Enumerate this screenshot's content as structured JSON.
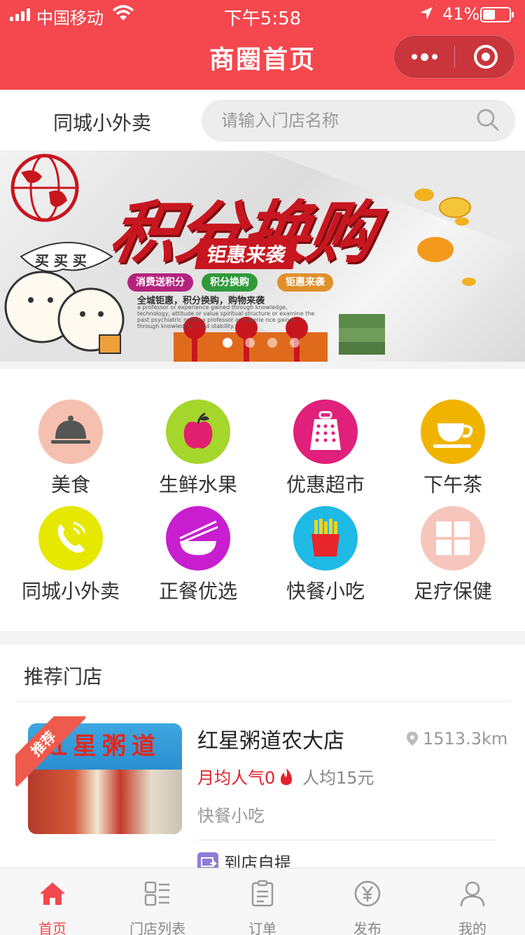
{
  "status_bar": {
    "carrier": "中国移动",
    "time": "下午5:58",
    "battery": "41%"
  },
  "nav": {
    "title": "商圈首页"
  },
  "search": {
    "city": "同城小外卖",
    "placeholder": "请输入门店名称"
  },
  "banner": {
    "headline": "积分换购",
    "subheadline": "钜惠来袭",
    "tags": [
      "消费送积分",
      "积分换购",
      "钜惠来袭"
    ],
    "line1": "全城钜惠，积分换购，购物来袭",
    "line2": "a professor or experience gained through knowledge, technology, attitude or value spiritual structure or examine the past psychiatric nodes a professor or experie nce gained through knowledge. r and stability.",
    "bubble": "买 买 买",
    "slide_count": 4,
    "active_slide": 0
  },
  "categories": [
    {
      "label": "美食",
      "icon": "cloche-icon",
      "color": "#f5c0b0"
    },
    {
      "label": "生鲜水果",
      "icon": "apple-icon",
      "color": "#a5d62b"
    },
    {
      "label": "优惠超市",
      "icon": "grater-icon",
      "color": "#e0207a"
    },
    {
      "label": "下午茶",
      "icon": "teacup-icon",
      "color": "#f0b400"
    },
    {
      "label": "同城小外卖",
      "icon": "phone-icon",
      "color": "#e6e800"
    },
    {
      "label": "正餐优选",
      "icon": "bowl-chopsticks-icon",
      "color": "#c81ecf"
    },
    {
      "label": "快餐小吃",
      "icon": "fries-icon",
      "color": "#1fb9e6"
    },
    {
      "label": "足疗保健",
      "icon": "window-icon",
      "color": "#f6c6bc"
    }
  ],
  "recommend": {
    "title": "推荐门店",
    "store": {
      "badge": "推荐",
      "sign_text": "红星粥道",
      "name": "红星粥道农大店",
      "distance": "1513.3km",
      "popularity": "月均人气0",
      "avg_price": "人均15元",
      "category": "快餐小吃",
      "service": "到店自提"
    }
  },
  "tabbar": {
    "items": [
      {
        "label": "首页",
        "icon": "home-icon"
      },
      {
        "label": "门店列表",
        "icon": "store-list-icon"
      },
      {
        "label": "订单",
        "icon": "order-icon"
      },
      {
        "label": "发布",
        "icon": "publish-yen-icon"
      },
      {
        "label": "我的",
        "icon": "profile-icon"
      }
    ],
    "active_index": 0
  },
  "colors": {
    "brand": "#f4474e",
    "accent_red": "#e2232b"
  }
}
